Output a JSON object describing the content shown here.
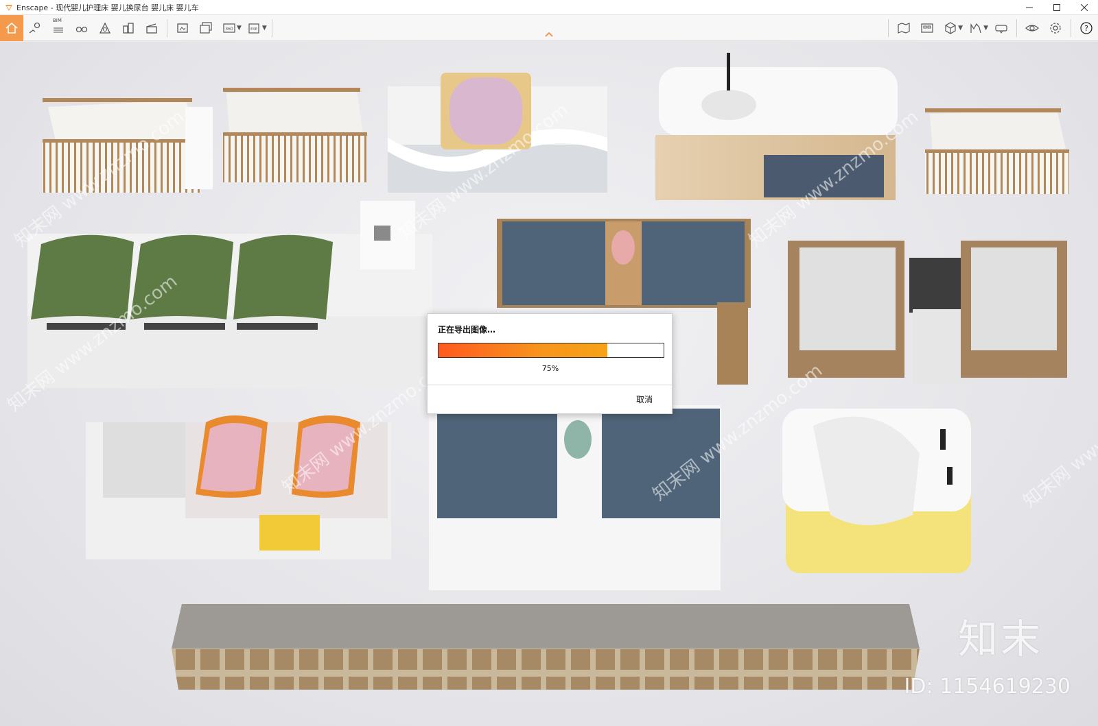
{
  "window": {
    "title": "Enscape - 现代婴儿护理床 婴儿换尿台 婴儿床 婴儿车",
    "accent": "#f39a4c"
  },
  "toolbar": {
    "bim_label": "BIM",
    "left_icons": [
      "home-icon",
      "map-pin-icon",
      "bim-list-icon",
      "binoculars-icon",
      "atmosphere-icon",
      "buildings-icon",
      "clapper-icon",
      "screenshot-icon",
      "batch-render-icon",
      "panorama-360-icon",
      "exe-export-icon"
    ],
    "right_icons": [
      "map-icon",
      "asset-library-icon",
      "view-cube-icon",
      "chart-icon",
      "vr-headset-icon",
      "eye-icon",
      "settings-icon",
      "help-icon"
    ]
  },
  "export_dialog": {
    "title": "正在导出图像…",
    "progress": 0.75,
    "progress_text": "75%",
    "cancel_label": "取消"
  },
  "watermark": {
    "logo_text": "知末",
    "id_text": "ID: 1154619230",
    "diagonal_text": "知末网 www.znzmo.com"
  }
}
